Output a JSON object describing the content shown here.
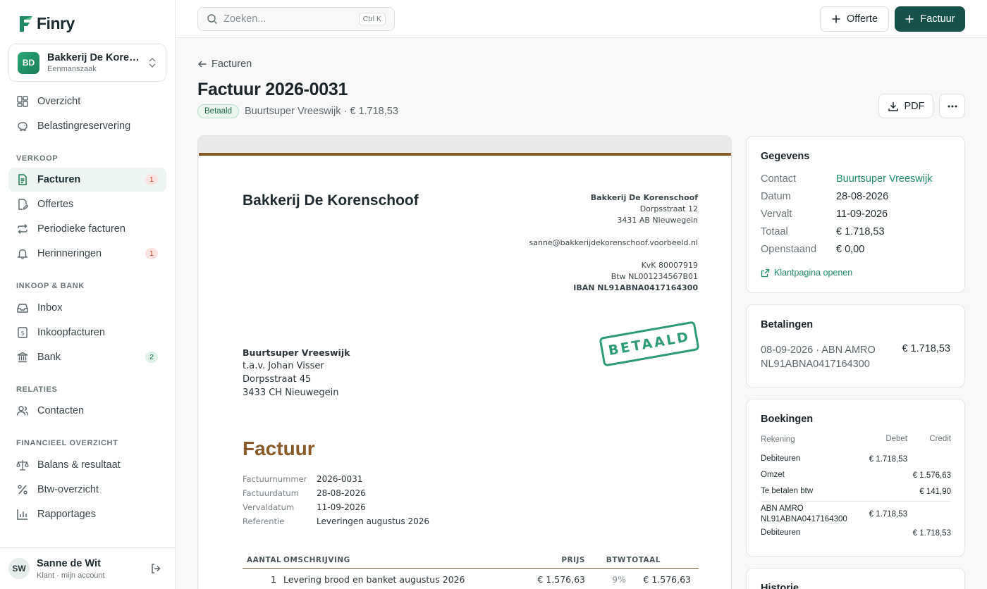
{
  "app": {
    "name": "Finry",
    "brand_color": "#17524a",
    "accent_color": "#1f8a63"
  },
  "company": {
    "initials": "BD",
    "name": "Bakkerij De Koren...",
    "type": "Eenmanszaak"
  },
  "nav": {
    "top": [
      {
        "label": "Overzicht",
        "icon": "grid-icon"
      },
      {
        "label": "Belastingreservering",
        "icon": "piggy-bank-icon"
      }
    ],
    "sections": [
      {
        "title": "VERKOOP",
        "items": [
          {
            "label": "Facturen",
            "icon": "document-icon",
            "badge": "1",
            "active": true
          },
          {
            "label": "Offertes",
            "icon": "file-edit-icon"
          },
          {
            "label": "Periodieke facturen",
            "icon": "repeat-icon"
          },
          {
            "label": "Herinneringen",
            "icon": "bell-icon",
            "badge": "1"
          }
        ]
      },
      {
        "title": "INKOOP & BANK",
        "items": [
          {
            "label": "Inbox",
            "icon": "inbox-icon"
          },
          {
            "label": "Inkoopfacturen",
            "icon": "receipt-icon"
          },
          {
            "label": "Bank",
            "icon": "bank-icon",
            "badge": "2"
          }
        ]
      },
      {
        "title": "RELATIES",
        "items": [
          {
            "label": "Contacten",
            "icon": "users-icon"
          }
        ]
      },
      {
        "title": "FINANCIEEL OVERZICHT",
        "items": [
          {
            "label": "Balans & resultaat",
            "icon": "scale-icon"
          },
          {
            "label": "Btw-overzicht",
            "icon": "percent-icon"
          },
          {
            "label": "Rapportages",
            "icon": "bar-chart-icon"
          }
        ]
      }
    ]
  },
  "user": {
    "initials": "SW",
    "name": "Sanne de Wit",
    "sub": "Klant · mijn account"
  },
  "topbar": {
    "search_placeholder": "Zoeken...",
    "shortcut": "Ctrl K",
    "btn_offerte": "Offerte",
    "btn_factuur": "Factuur"
  },
  "page": {
    "back_label": "Facturen",
    "title": "Factuur 2026-0031",
    "status": "Betaald",
    "subtitle": "Buurtsuper Vreeswijk · € 1.718,53",
    "pdf_label": "PDF"
  },
  "document": {
    "company": "Bakkerij De Korenschoof",
    "sender": {
      "name": "Bakkerij De Korenschoof",
      "street": "Dorpsstraat 12",
      "city": "3431 AB Nieuwegein",
      "email": "sanne@bakkerijdekorenschoof.voorbeeld.nl",
      "kvk": "KvK 80007919",
      "btw": "Btw NL001234567B01",
      "iban": "IBAN NL91ABNA0417164300"
    },
    "stamp": "BETAALD",
    "recipient": {
      "name": "Buurtsuper Vreeswijk",
      "attn": "t.a.v. Johan Visser",
      "street": "Dorpsstraat 45",
      "city": "3433 CH Nieuwegein"
    },
    "heading": "Factuur",
    "meta": [
      {
        "k": "Factuurnummer",
        "v": "2026-0031"
      },
      {
        "k": "Factuurdatum",
        "v": "28-08-2026"
      },
      {
        "k": "Vervaldatum",
        "v": "11-09-2026"
      },
      {
        "k": "Referentie",
        "v": "Leveringen augustus 2026"
      }
    ],
    "columns": {
      "qty": "AANTAL",
      "desc": "OMSCHRIJVING",
      "price": "PRIJS",
      "btw": "BTW",
      "total": "TOTAAL"
    },
    "lines": [
      {
        "qty": "1",
        "desc": "Levering brood en banket augustus 2026",
        "price": "€ 1.576,63",
        "btw": "9%",
        "total": "€ 1.576,63"
      }
    ]
  },
  "gegevens": {
    "title": "Gegevens",
    "rows": [
      {
        "k": "Contact",
        "v": "Buurtsuper Vreeswijk"
      },
      {
        "k": "Datum",
        "v": "28-08-2026"
      },
      {
        "k": "Vervalt",
        "v": "11-09-2026"
      },
      {
        "k": "Totaal",
        "v": "€ 1.718,53"
      },
      {
        "k": "Openstaand",
        "v": "€ 0,00"
      }
    ],
    "link": "Klantpagina openen"
  },
  "betalingen": {
    "title": "Betalingen",
    "line1": "08-09-2026 · ABN AMRO",
    "line2": "NL91ABNA0417164300",
    "amount": "€ 1.718,53"
  },
  "boekingen": {
    "title": "Boekingen",
    "head": {
      "acc": "Rekening",
      "deb": "Debet",
      "cre": "Credit"
    },
    "rows": [
      {
        "acc": "Debiteuren",
        "deb": "€ 1.718,53",
        "cre": ""
      },
      {
        "acc": "Omzet",
        "deb": "",
        "cre": "€ 1.576,63"
      },
      {
        "acc": "Te betalen btw",
        "deb": "",
        "cre": "€ 141,90"
      },
      {
        "acc": "ABN AMRO NL91ABNA0417164300",
        "deb": "€ 1.718,53",
        "cre": ""
      },
      {
        "acc": "Debiteuren",
        "deb": "",
        "cre": "€ 1.718,53"
      }
    ]
  },
  "historie": {
    "title": "Historie"
  }
}
